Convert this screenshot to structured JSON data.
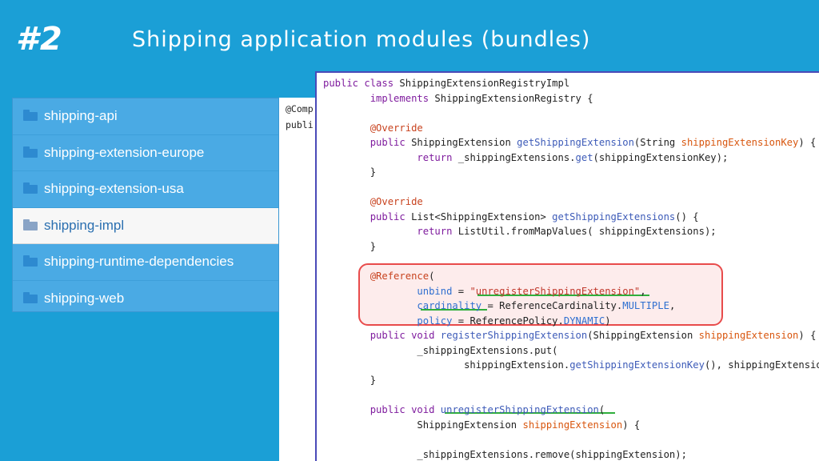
{
  "slide": {
    "number": "#2",
    "title": "Shipping application modules (bundles)"
  },
  "tree": {
    "items": [
      {
        "label": "shipping-api",
        "icon": "folder-icon"
      },
      {
        "label": "shipping-extension-europe",
        "icon": "folder-icon"
      },
      {
        "label": "shipping-extension-usa",
        "icon": "folder-icon"
      },
      {
        "label": "shipping-impl",
        "icon": "folder-icon",
        "selected": true
      },
      {
        "label": "shipping-runtime-dependencies",
        "icon": "folder-icon"
      },
      {
        "label": "shipping-web",
        "icon": "folder-icon"
      }
    ]
  },
  "back_code": {
    "lines": [
      "@Comp",
      "publi"
    ]
  },
  "code": {
    "lines": [
      "public class ShippingExtensionRegistryImpl",
      "        implements ShippingExtensionRegistry {",
      "",
      "        @Override",
      "        public ShippingExtension getShippingExtension(String shippingExtensionKey) {",
      "                return _shippingExtensions.get(shippingExtensionKey);",
      "        }",
      "",
      "        @Override",
      "        public List<ShippingExtension> getShippingExtensions() {",
      "                return ListUtil.fromMapValues( shippingExtensions);",
      "        }",
      "",
      "        @Reference(",
      "                unbind = \"unregisterShippingExtension\",",
      "                cardinality = ReferenceCardinality.MULTIPLE,",
      "                policy = ReferencePolicy.DYNAMIC)",
      "        public void registerShippingExtension(ShippingExtension shippingExtension) {",
      "                _shippingExtensions.put(",
      "                        shippingExtension.getShippingExtensionKey(), shippingExtension);",
      "        }",
      "",
      "        public void unregisterShippingExtension(",
      "                ShippingExtension shippingExtension) {",
      "",
      "                _shippingExtensions.remove(shippingExtension);"
    ]
  },
  "colors": {
    "background": "#1b9fd6",
    "tree_bg": "#4aaae4",
    "highlight_border": "#e84b4b",
    "underline": "#2fae3c"
  }
}
